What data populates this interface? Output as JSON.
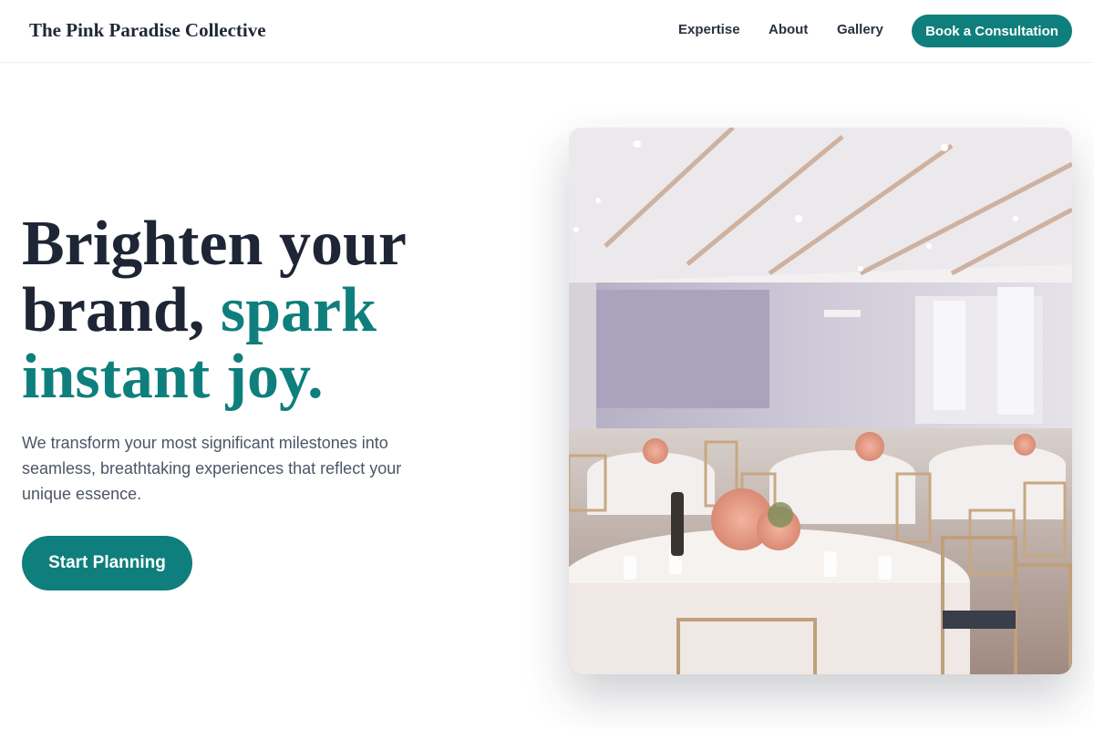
{
  "header": {
    "brand": "The Pink Paradise Collective",
    "nav": [
      {
        "label": "Expertise"
      },
      {
        "label": "About"
      },
      {
        "label": "Gallery"
      }
    ],
    "cta_label": "Book a Consultation"
  },
  "hero": {
    "headline_line1": "Brighten your",
    "headline_line2_plain": "brand, ",
    "headline_line2_accent": "spark",
    "headline_line3_accent": "instant joy.",
    "subtext": "We transform your most significant milestones into seamless, breathtaking experiences that reflect your unique essence.",
    "cta_label": "Start Planning",
    "image_subject": "wedding-reception-hall"
  },
  "colors": {
    "accent": "#0e7f7c",
    "text_dark": "#1e2535",
    "text_muted": "#4d5566"
  }
}
